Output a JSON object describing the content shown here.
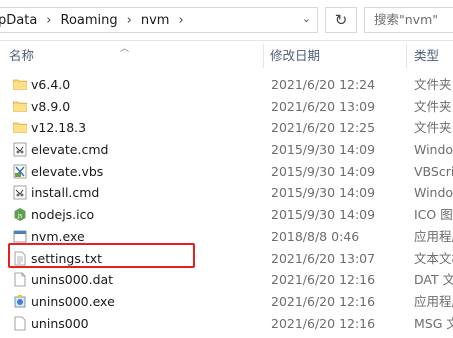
{
  "address": {
    "crumbs": [
      "pData",
      "Roaming",
      "nvm"
    ],
    "search_placeholder": "搜索\"nvm\""
  },
  "columns": {
    "name": "名称",
    "date": "修改日期",
    "type": "类型"
  },
  "files": [
    {
      "name": "v6.4.0",
      "date": "2021/6/20 12:24",
      "type": "文件夹",
      "icon": "folder-icon"
    },
    {
      "name": "v8.9.0",
      "date": "2021/6/20 13:09",
      "type": "文件夹",
      "icon": "folder-icon"
    },
    {
      "name": "v12.18.3",
      "date": "2021/6/20 12:25",
      "type": "文件夹",
      "icon": "folder-icon"
    },
    {
      "name": "elevate.cmd",
      "date": "2015/9/30 14:09",
      "type": "Window",
      "icon": "cmd-file-icon"
    },
    {
      "name": "elevate.vbs",
      "date": "2015/9/30 14:09",
      "type": "VBScrip",
      "icon": "vbs-file-icon"
    },
    {
      "name": "install.cmd",
      "date": "2015/9/30 14:09",
      "type": "Window",
      "icon": "cmd-file-icon"
    },
    {
      "name": "nodejs.ico",
      "date": "2015/9/30 14:09",
      "type": "ICO 图片",
      "icon": "nodejs-icon"
    },
    {
      "name": "nvm.exe",
      "date": "2018/8/8 0:46",
      "type": "应用程序",
      "icon": "exe-file-icon"
    },
    {
      "name": "settings.txt",
      "date": "2021/6/20 13:07",
      "type": "文本文档",
      "icon": "text-file-icon"
    },
    {
      "name": "unins000.dat",
      "date": "2021/6/20 12:16",
      "type": "DAT 文件",
      "icon": "dat-file-icon"
    },
    {
      "name": "unins000.exe",
      "date": "2021/6/20 12:16",
      "type": "应用程序",
      "icon": "installer-icon"
    },
    {
      "name": "unins000",
      "date": "2021/6/20 12:16",
      "type": "MSG 文件",
      "icon": "generic-file-icon"
    }
  ]
}
